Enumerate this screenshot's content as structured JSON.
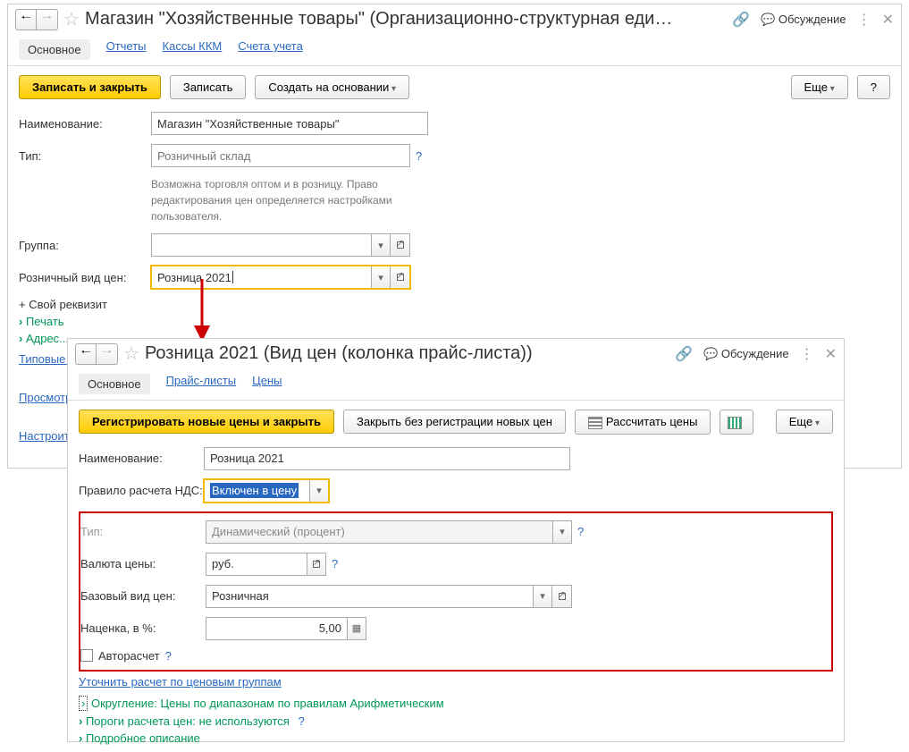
{
  "w1": {
    "title": "Магазин \"Хозяйственные товары\" (Организационно-структурная единица...",
    "discuss": "Обсуждение",
    "tabs": {
      "main": "Основное",
      "reports": "Отчеты",
      "kkm": "Кассы ККМ",
      "accounts": "Счета учета"
    },
    "toolbar": {
      "save_close": "Записать и закрыть",
      "save": "Записать",
      "create_based": "Создать на основании",
      "more": "Еще"
    },
    "fields": {
      "name_label": "Наименование:",
      "name_value": "Магазин \"Хозяйственные товары\"",
      "type_label": "Тип:",
      "type_value": "Розничный склад",
      "type_help": "Возможна торговля оптом и в розницу. Право редактирования цен определяется настройками пользователя.",
      "group_label": "Группа:",
      "group_value": "",
      "retail_price_label": "Розничный вид цен:",
      "retail_price_value": "Розница 2021"
    },
    "links": {
      "own_prop": "Свой реквизит",
      "print": "Печать",
      "addresses": "Адрес...",
      "typical": "Типовые ...",
      "view": "Просмотр...",
      "setup": "Настроит..."
    }
  },
  "w2": {
    "title": "Розница 2021 (Вид цен (колонка прайс-листа))",
    "discuss": "Обсуждение",
    "tabs": {
      "main": "Основное",
      "pricelists": "Прайс-листы",
      "prices": "Цены"
    },
    "toolbar": {
      "register_close": "Регистрировать новые цены и закрыть",
      "close_noreg": "Закрыть без регистрации новых цен",
      "calc": "Рассчитать цены",
      "more": "Еще"
    },
    "fields": {
      "name_label": "Наименование:",
      "name_value": "Розница 2021",
      "vat_label": "Правило расчета НДС:",
      "vat_value": "Включен в цену",
      "type_label": "Тип:",
      "type_value": "Динамический (процент)",
      "currency_label": "Валюта цены:",
      "currency_value": "руб.",
      "base_label": "Базовый вид цен:",
      "base_value": "Розничная",
      "markup_label": "Наценка, в %:",
      "markup_value": "5,00",
      "autocalc_label": "Авторасчет"
    },
    "links": {
      "refine": "Уточнить расчет по ценовым группам",
      "rounding": "Округление: Цены по диапазонам по правилам Арифметическим",
      "thresholds": "Пороги расчета цен: не используются",
      "detail": "Подробное описание"
    }
  }
}
